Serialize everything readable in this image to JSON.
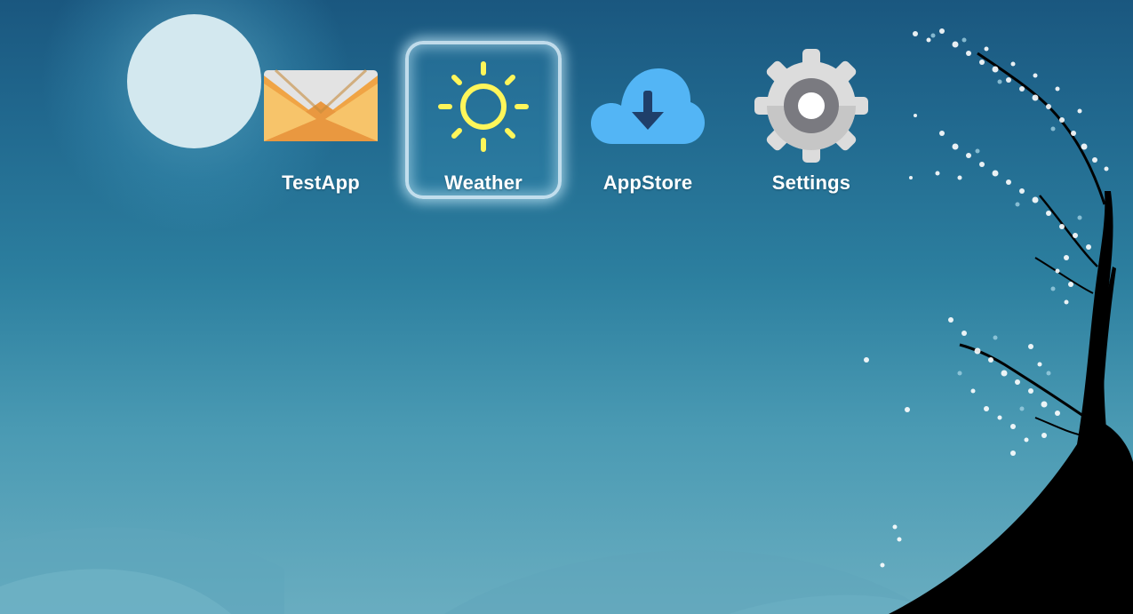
{
  "desktop": {
    "wallpaper": {
      "sky_top_color": "#1a577f",
      "sky_bottom_color": "#69adc0",
      "moon_color": "#d3e8ef",
      "tree_color": "#000000",
      "blossom_color": "#ffffff"
    },
    "apps": [
      {
        "label": "TestApp",
        "icon": "mail-envelope-icon",
        "selected": false
      },
      {
        "label": "Weather",
        "icon": "sun-icon",
        "selected": true
      },
      {
        "label": "AppStore",
        "icon": "cloud-download-icon",
        "selected": false
      },
      {
        "label": "Settings",
        "icon": "gear-icon",
        "selected": false
      }
    ],
    "focus_color": "#dcf0fa"
  }
}
